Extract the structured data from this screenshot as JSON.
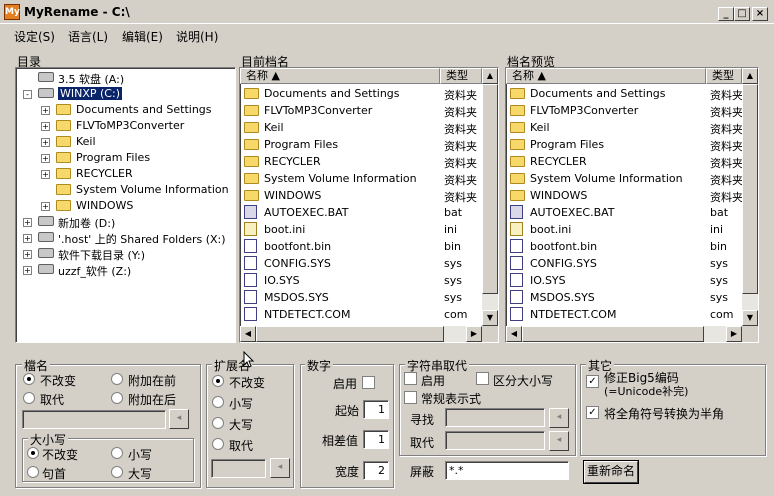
{
  "window": {
    "icon_text": "My",
    "title": "MyRename - C:\\",
    "controls": [
      "_",
      "□",
      "×"
    ]
  },
  "menu": [
    {
      "label": "设定(S)"
    },
    {
      "label": "语言(L)"
    },
    {
      "label": "编辑(E)"
    },
    {
      "label": "说明(H)"
    }
  ],
  "panes": {
    "tree_label": "目录",
    "current_label": "目前档名",
    "preview_label": "档名预览"
  },
  "tree": [
    {
      "label": "3.5 软盘 (A:)",
      "icon": "floppy-icon",
      "level": 0,
      "expander": ""
    },
    {
      "label": "WINXP (C:)",
      "icon": "drive-icon",
      "level": 0,
      "expander": "-",
      "selected": true
    },
    {
      "label": "Documents and Settings",
      "icon": "folder-icon",
      "level": 1,
      "expander": "+"
    },
    {
      "label": "FLVToMP3Converter",
      "icon": "folder-icon",
      "level": 1,
      "expander": "+"
    },
    {
      "label": "Keil",
      "icon": "folder-icon",
      "level": 1,
      "expander": "+"
    },
    {
      "label": "Program Files",
      "icon": "folder-icon",
      "level": 1,
      "expander": "+"
    },
    {
      "label": "RECYCLER",
      "icon": "folder-icon",
      "level": 1,
      "expander": "+"
    },
    {
      "label": "System Volume Information",
      "icon": "folder-icon",
      "level": 1,
      "expander": ""
    },
    {
      "label": "WINDOWS",
      "icon": "folder-icon",
      "level": 1,
      "expander": "+"
    },
    {
      "label": "新加卷 (D:)",
      "icon": "drive-icon",
      "level": 0,
      "expander": "+"
    },
    {
      "label": "'.host' 上的 Shared Folders (X:)",
      "icon": "network-drive-icon",
      "level": 0,
      "expander": "+"
    },
    {
      "label": "软件下载目录 (Y:)",
      "icon": "network-drive-icon",
      "level": 0,
      "expander": "+"
    },
    {
      "label": "uzzf_软件 (Z:)",
      "icon": "network-drive-icon",
      "level": 0,
      "expander": "+"
    }
  ],
  "list_headers": {
    "name": "名称",
    "type": "类型"
  },
  "files": [
    {
      "name": "Documents and Settings",
      "type": "资料夹",
      "icon": "folder-icon"
    },
    {
      "name": "FLVToMP3Converter",
      "type": "资料夹",
      "icon": "folder-icon"
    },
    {
      "name": "Keil",
      "type": "资料夹",
      "icon": "folder-icon"
    },
    {
      "name": "Program Files",
      "type": "资料夹",
      "icon": "folder-icon"
    },
    {
      "name": "RECYCLER",
      "type": "资料夹",
      "icon": "folder-icon"
    },
    {
      "name": "System Volume Information",
      "type": "资料夹",
      "icon": "folder-icon"
    },
    {
      "name": "WINDOWS",
      "type": "资料夹",
      "icon": "folder-icon"
    },
    {
      "name": "AUTOEXEC.BAT",
      "type": "bat",
      "icon": "bat-file-icon"
    },
    {
      "name": "boot.ini",
      "type": "ini",
      "icon": "ini-file-icon"
    },
    {
      "name": "bootfont.bin",
      "type": "bin",
      "icon": "file-icon"
    },
    {
      "name": "CONFIG.SYS",
      "type": "sys",
      "icon": "file-icon"
    },
    {
      "name": "IO.SYS",
      "type": "sys",
      "icon": "file-icon"
    },
    {
      "name": "MSDOS.SYS",
      "type": "sys",
      "icon": "file-icon"
    },
    {
      "name": "NTDETECT.COM",
      "type": "com",
      "icon": "file-icon"
    }
  ],
  "filename_group": {
    "title": "檔名",
    "options": [
      {
        "label": "不改变",
        "checked": true
      },
      {
        "label": "附加在前",
        "checked": false
      },
      {
        "label": "取代",
        "checked": false
      },
      {
        "label": "附加在后",
        "checked": false
      }
    ],
    "input_value": "",
    "case_group": {
      "title": "大小写",
      "options": [
        {
          "label": "不改变",
          "checked": true
        },
        {
          "label": "小写",
          "checked": false
        },
        {
          "label": "句首",
          "checked": false
        },
        {
          "label": "大写",
          "checked": false
        }
      ]
    }
  },
  "ext_group": {
    "title": "扩展名",
    "options": [
      {
        "label": "不改变",
        "checked": true
      },
      {
        "label": "小写",
        "checked": false
      },
      {
        "label": "大写",
        "checked": false
      },
      {
        "label": "取代",
        "checked": false
      }
    ],
    "input_value": ""
  },
  "number_group": {
    "title": "数字",
    "enable_label": "启用",
    "enable_checked": false,
    "start_label": "起始",
    "start_value": "1",
    "step_label": "相差值",
    "step_value": "1",
    "width_label": "宽度",
    "width_value": "2"
  },
  "replace_group": {
    "title": "字符串取代",
    "enable_label": "启用",
    "enable_checked": false,
    "case_label": "区分大小写",
    "case_checked": false,
    "regex_label": "常规表示式",
    "regex_checked": false,
    "find_label": "寻找",
    "find_value": "",
    "replace_label": "取代",
    "replace_value": ""
  },
  "mask": {
    "label": "屏蔽",
    "value": "*.*"
  },
  "other_group": {
    "title": "其它",
    "big5_label": "修正Big5编码",
    "big5_sub": "(=Unicode补完)",
    "big5_checked": true,
    "fullwidth_label": "将全角符号转换为半角",
    "fullwidth_checked": true
  },
  "rename_button": "重新命名"
}
